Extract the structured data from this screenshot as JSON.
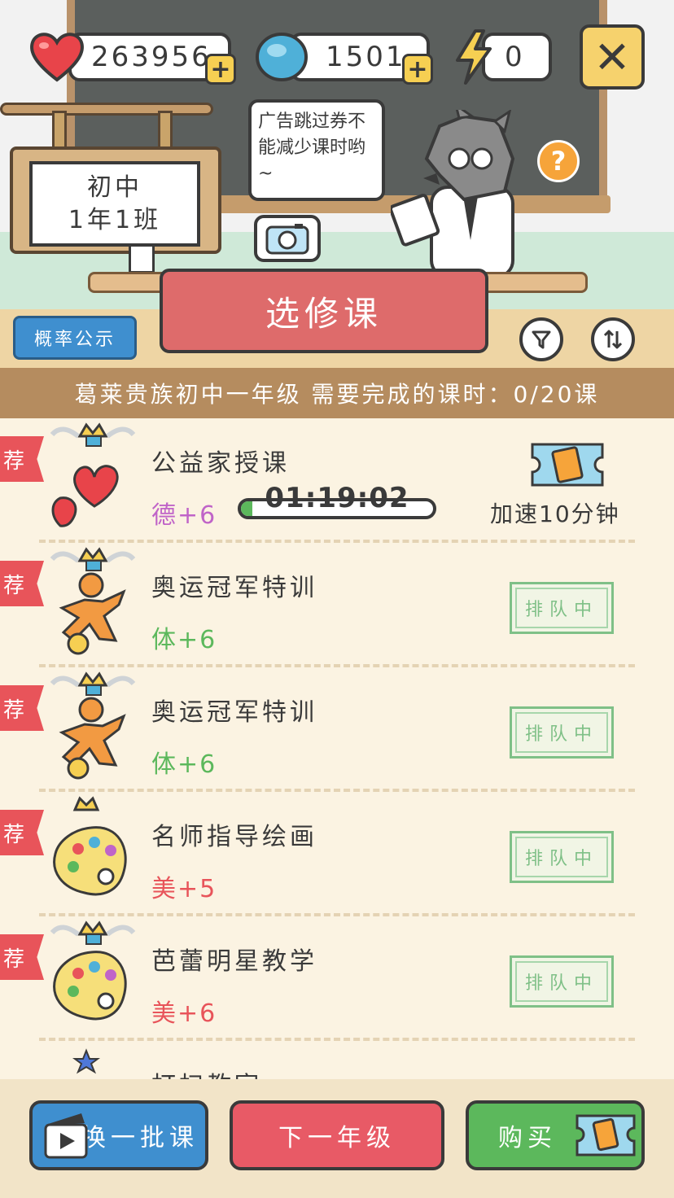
{
  "currency": {
    "hearts": "263956",
    "gems": "1501",
    "energy": "0"
  },
  "icons": {
    "heart": "heart-icon",
    "gem": "gem-icon",
    "energy": "lightning-icon",
    "close": "close-icon",
    "camera": "camera-icon",
    "help": "question-icon",
    "filter": "filter-icon",
    "sort": "sort-icon",
    "ticket": "speed-ticket-icon",
    "video": "video-icon"
  },
  "class_sign": {
    "line1": "初中",
    "line2": "1年1班"
  },
  "speech_bubble": "广告跳过券不能减少课时哟~",
  "help_symbol": "?",
  "title_button": "选修课",
  "odds_button": "概率公示",
  "requirement_text": "葛莱贵族初中一年级 需要完成的课时：0/20课",
  "recommend_tag": "荐",
  "courses": [
    {
      "name": "公益家授课",
      "stat": "德+6",
      "stat_color": "#c064c8",
      "status": "active",
      "timer": "01:19:02",
      "progress": 0.06,
      "action_label": "加速10分钟"
    },
    {
      "name": "奥运冠军特训",
      "stat": "体+6",
      "stat_color": "#5cb85c",
      "status": "排队中"
    },
    {
      "name": "奥运冠军特训",
      "stat": "体+6",
      "stat_color": "#5cb85c",
      "status": "排队中"
    },
    {
      "name": "名师指导绘画",
      "stat": "美+5",
      "stat_color": "#e8545a",
      "status": "排队中"
    },
    {
      "name": "芭蕾明星教学",
      "stat": "美+6",
      "stat_color": "#e8545a",
      "status": "排队中"
    },
    {
      "name": "打扫教室"
    }
  ],
  "bottom": {
    "refresh": "换一批课",
    "next_grade": "下一年级",
    "buy": "购买"
  },
  "colors": {
    "accent_red": "#de6b6b",
    "blue": "#3f8fcf",
    "green": "#5cb85c",
    "wood": "#b58c5f"
  }
}
